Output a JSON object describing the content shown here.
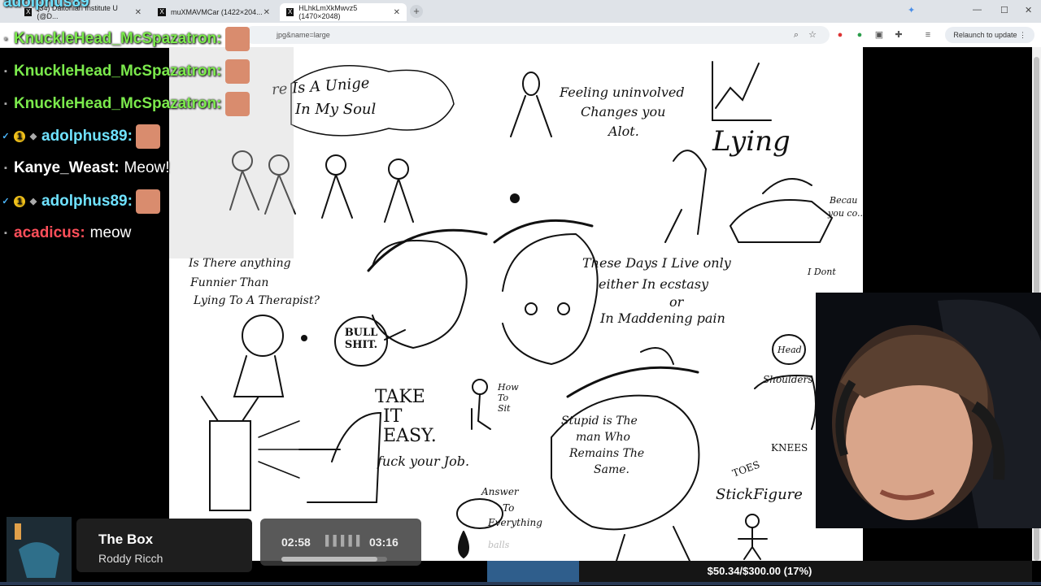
{
  "browser": {
    "tabs": [
      {
        "label": "(34) Daltonian Institute U (@D...",
        "active": false
      },
      {
        "label": "muXMAVMCar (1422×204...",
        "active": false
      },
      {
        "label": "HLhkLmXkMwvz5 (1470×2048)",
        "active": true
      }
    ],
    "url_fragment": "jpg&name=large",
    "relaunch_label": "Relaunch to update"
  },
  "chat": {
    "messages": [
      {
        "user": "adolphus89",
        "text": "",
        "color": "#6fe2ff"
      },
      {
        "user": "KnuckleHead_McSpazatron:",
        "text": "",
        "color": "#7bea4c"
      },
      {
        "user": "KnuckleHead_McSpazatron:",
        "text": "",
        "color": "#7bea4c"
      },
      {
        "user": "KnuckleHead_McSpazatron:",
        "text": "",
        "color": "#7bea4c"
      },
      {
        "user": "adolphus89:",
        "text": "",
        "color": "#6fe2ff"
      },
      {
        "user": "Kanye_Weast:",
        "text": "Meow!",
        "color": "#ffffff"
      },
      {
        "user": "adolphus89:",
        "text": "",
        "color": "#6fe2ff"
      },
      {
        "user": "acadicus:",
        "text": "meow",
        "color": "#ff4f5a"
      }
    ]
  },
  "drawing": {
    "texts": {
      "soul_line1": "re Is A Unige",
      "soul_line2": "In My Soul",
      "uninvolved": "Feeling uninvolved",
      "changes": "Changes you",
      "alot": "Alot.",
      "lying": "Lying",
      "because": "Becau",
      "you_co": "you co..",
      "funnier1": "Is There anything",
      "funnier2": "Funnier Than",
      "funnier3": "Lying To A Therapist?",
      "days1": "These Days I Live only",
      "days2": "either In ecstasy",
      "days3": "or",
      "days4": "In Maddening pain",
      "dont_want": "I Dont",
      "bullshit": "BULL SHIT.",
      "take1": "TAKE",
      "take2": "IT",
      "take3": "EASY.",
      "fuck_job": "fuck your Job.",
      "how_to_sit": "How To Sit",
      "stupid1": "Stupid is The",
      "stupid2": "man Who",
      "stupid3": "Remains The",
      "stupid4": "Same.",
      "answer1": "Answer",
      "answer2": "To",
      "answer3": "Everything",
      "balls": "balls",
      "head": "Head",
      "shoulders": "Shoulders",
      "knees": "KNEES",
      "toes": "TOES",
      "stickfigure": "StickFigure"
    }
  },
  "now_playing": {
    "title": "The Box",
    "artist": "Roddy Ricch",
    "elapsed": "02:58",
    "total": "03:16",
    "progress": 0.908
  },
  "goal": {
    "label": "$50.34/$300.00 (17%)",
    "fraction": 0.168
  }
}
